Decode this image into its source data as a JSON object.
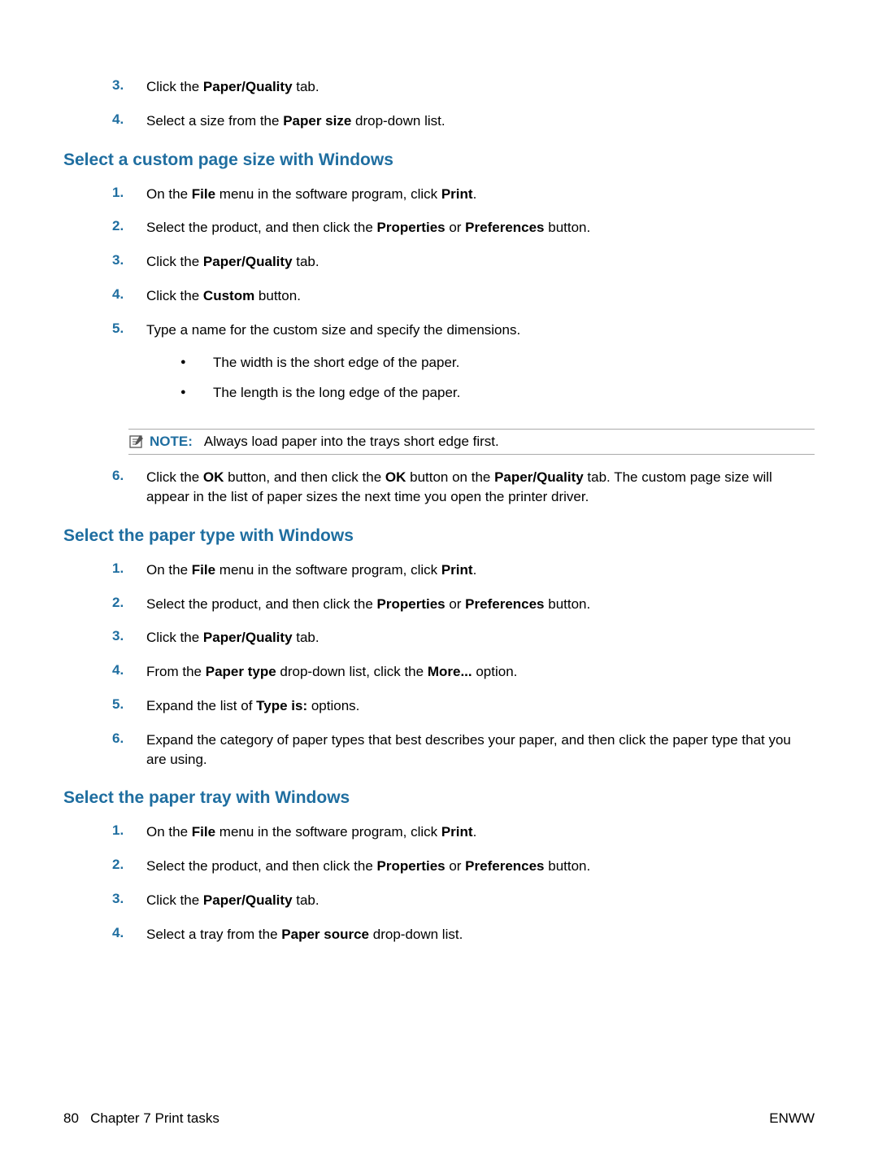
{
  "intro": {
    "items": [
      {
        "num": "3.",
        "html": "Click the <b>Paper/Quality</b> tab."
      },
      {
        "num": "4.",
        "html": "Select a size from the <b>Paper size</b> drop-down list."
      }
    ]
  },
  "sections": [
    {
      "title": "Select a custom page size with Windows",
      "items": [
        {
          "num": "1.",
          "html": "On the <b>File</b> menu in the software program, click <b>Print</b>."
        },
        {
          "num": "2.",
          "html": "Select the product, and then click the <b>Properties</b> or <b>Preferences</b> button."
        },
        {
          "num": "3.",
          "html": "Click the <b>Paper/Quality</b> tab."
        },
        {
          "num": "4.",
          "html": "Click the <b>Custom</b> button."
        },
        {
          "num": "5.",
          "html": "Type a name for the custom size and specify the dimensions.",
          "sub": [
            "The width is the short edge of the paper.",
            "The length is the long edge of the paper."
          ]
        }
      ],
      "note": {
        "label": "NOTE:",
        "text": "Always load paper into the trays short edge first."
      },
      "after_note": [
        {
          "num": "6.",
          "html": "Click the <b>OK</b> button, and then click the <b>OK</b> button on the <b>Paper/Quality</b> tab. The custom page size will appear in the list of paper sizes the next time you open the printer driver."
        }
      ]
    },
    {
      "title": "Select the paper type with Windows",
      "items": [
        {
          "num": "1.",
          "html": "On the <b>File</b> menu in the software program, click <b>Print</b>."
        },
        {
          "num": "2.",
          "html": "Select the product, and then click the <b>Properties</b> or <b>Preferences</b> button."
        },
        {
          "num": "3.",
          "html": "Click the <b>Paper/Quality</b> tab."
        },
        {
          "num": "4.",
          "html": "From the <b>Paper type</b> drop-down list, click the <b>More...</b> option."
        },
        {
          "num": "5.",
          "html": "Expand the list of <b>Type is:</b> options."
        },
        {
          "num": "6.",
          "html": "Expand the category of paper types that best describes your paper, and then click the paper type that you are using."
        }
      ]
    },
    {
      "title": "Select the paper tray with Windows",
      "items": [
        {
          "num": "1.",
          "html": "On the <b>File</b> menu in the software program, click <b>Print</b>."
        },
        {
          "num": "2.",
          "html": "Select the product, and then click the <b>Properties</b> or <b>Preferences</b> button."
        },
        {
          "num": "3.",
          "html": "Click the <b>Paper/Quality</b> tab."
        },
        {
          "num": "4.",
          "html": "Select a tray from the <b>Paper source</b> drop-down list."
        }
      ]
    }
  ],
  "footer": {
    "page": "80",
    "chapter": "Chapter 7   Print tasks",
    "right": "ENWW"
  }
}
